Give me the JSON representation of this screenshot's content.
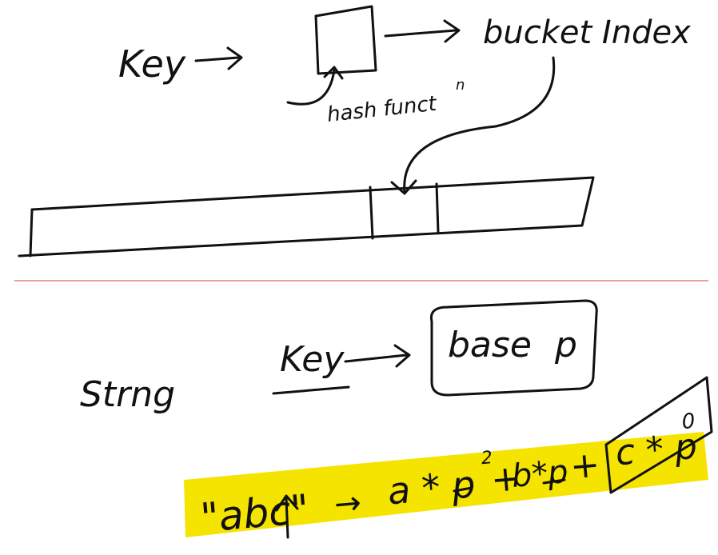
{
  "top": {
    "key_label": "Key",
    "bucket_label": "bucket Index",
    "hash_label": "hash funct",
    "hash_sup": "n"
  },
  "bottom": {
    "string_label": "Strng",
    "key_label": "Key",
    "base_label": "base",
    "base_var": "p",
    "formula_lhs": "\"abc\"",
    "formula_arrow": "→",
    "formula_term1": "a * p",
    "formula_exp1": "2",
    "formula_plus1": "+",
    "formula_term2": "b*p",
    "formula_plus2": "+",
    "formula_term3": "c * p",
    "formula_exp3": "0"
  },
  "colors": {
    "ink": "#111111",
    "highlight": "#f5e300",
    "divider": "#e8a0a0"
  }
}
